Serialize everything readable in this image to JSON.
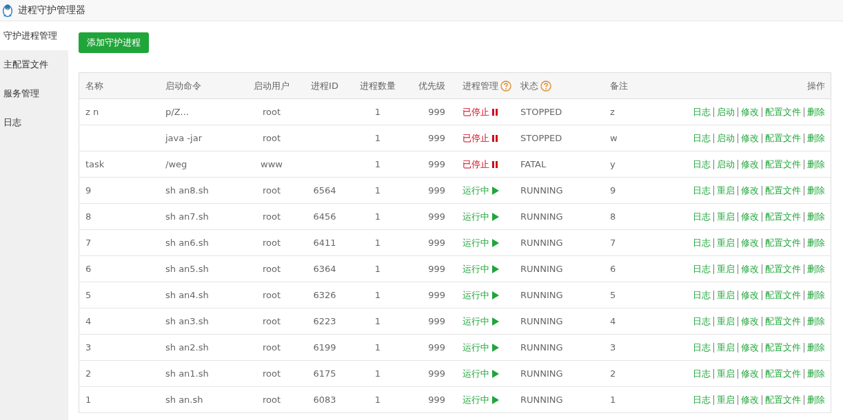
{
  "window": {
    "title": "进程守护管理器"
  },
  "sidebar": {
    "items": [
      {
        "label": "守护进程管理",
        "selected": true
      },
      {
        "label": "主配置文件",
        "selected": false
      },
      {
        "label": "服务管理",
        "selected": false
      },
      {
        "label": "日志",
        "selected": false
      }
    ]
  },
  "add_button": "添加守护进程",
  "table": {
    "columns": [
      {
        "label": "名称",
        "help": false
      },
      {
        "label": "启动命令",
        "help": false
      },
      {
        "label": "启动用户",
        "help": false
      },
      {
        "label": "进程ID",
        "help": false
      },
      {
        "label": "进程数量",
        "help": false
      },
      {
        "label": "优先级",
        "help": false
      },
      {
        "label": "进程管理",
        "help": true
      },
      {
        "label": "状态",
        "help": true
      },
      {
        "label": "备注",
        "help": false
      },
      {
        "label": "操作",
        "help": false
      }
    ],
    "rows": [
      {
        "name": "z n",
        "command": "p/Z...",
        "user": "root",
        "pid": "",
        "count": "1",
        "priority": "999",
        "manage": {
          "kind": "stopped",
          "label": "已停止"
        },
        "status": "STOPPED",
        "remark": "z",
        "actions": [
          "日志",
          "启动",
          "修改",
          "配置文件",
          "删除"
        ]
      },
      {
        "name": "",
        "command": "java -jar",
        "user": "root",
        "pid": "",
        "count": "1",
        "priority": "999",
        "manage": {
          "kind": "stopped",
          "label": "已停止"
        },
        "status": "STOPPED",
        "remark": "w",
        "actions": [
          "日志",
          "启动",
          "修改",
          "配置文件",
          "删除"
        ]
      },
      {
        "name": "task",
        "command": "/weg",
        "user": "www",
        "pid": "",
        "count": "1",
        "priority": "999",
        "manage": {
          "kind": "stopped",
          "label": "已停止"
        },
        "status": "FATAL",
        "remark": "y",
        "actions": [
          "日志",
          "启动",
          "修改",
          "配置文件",
          "删除"
        ]
      },
      {
        "name": "9",
        "command": "sh an8.sh",
        "user": "root",
        "pid": "6564",
        "count": "1",
        "priority": "999",
        "manage": {
          "kind": "running",
          "label": "运行中"
        },
        "status": "RUNNING",
        "remark": "9",
        "actions": [
          "日志",
          "重启",
          "修改",
          "配置文件",
          "删除"
        ]
      },
      {
        "name": "8",
        "command": "sh an7.sh",
        "user": "root",
        "pid": "6456",
        "count": "1",
        "priority": "999",
        "manage": {
          "kind": "running",
          "label": "运行中"
        },
        "status": "RUNNING",
        "remark": "8",
        "actions": [
          "日志",
          "重启",
          "修改",
          "配置文件",
          "删除"
        ]
      },
      {
        "name": "7",
        "command": "sh an6.sh",
        "user": "root",
        "pid": "6411",
        "count": "1",
        "priority": "999",
        "manage": {
          "kind": "running",
          "label": "运行中"
        },
        "status": "RUNNING",
        "remark": "7",
        "actions": [
          "日志",
          "重启",
          "修改",
          "配置文件",
          "删除"
        ]
      },
      {
        "name": "6",
        "command": "sh an5.sh",
        "user": "root",
        "pid": "6364",
        "count": "1",
        "priority": "999",
        "manage": {
          "kind": "running",
          "label": "运行中"
        },
        "status": "RUNNING",
        "remark": "6",
        "actions": [
          "日志",
          "重启",
          "修改",
          "配置文件",
          "删除"
        ]
      },
      {
        "name": "5",
        "command": "sh an4.sh",
        "user": "root",
        "pid": "6326",
        "count": "1",
        "priority": "999",
        "manage": {
          "kind": "running",
          "label": "运行中"
        },
        "status": "RUNNING",
        "remark": "5",
        "actions": [
          "日志",
          "重启",
          "修改",
          "配置文件",
          "删除"
        ]
      },
      {
        "name": "4",
        "command": "sh an3.sh",
        "user": "root",
        "pid": "6223",
        "count": "1",
        "priority": "999",
        "manage": {
          "kind": "running",
          "label": "运行中"
        },
        "status": "RUNNING",
        "remark": "4",
        "actions": [
          "日志",
          "重启",
          "修改",
          "配置文件",
          "删除"
        ]
      },
      {
        "name": "3",
        "command": "sh an2.sh",
        "user": "root",
        "pid": "6199",
        "count": "1",
        "priority": "999",
        "manage": {
          "kind": "running",
          "label": "运行中"
        },
        "status": "RUNNING",
        "remark": "3",
        "actions": [
          "日志",
          "重启",
          "修改",
          "配置文件",
          "删除"
        ]
      },
      {
        "name": "2",
        "command": "sh an1.sh",
        "user": "root",
        "pid": "6175",
        "count": "1",
        "priority": "999",
        "manage": {
          "kind": "running",
          "label": "运行中"
        },
        "status": "RUNNING",
        "remark": "2",
        "actions": [
          "日志",
          "重启",
          "修改",
          "配置文件",
          "删除"
        ]
      },
      {
        "name": "1",
        "command": "sh an.sh",
        "user": "root",
        "pid": "6083",
        "count": "1",
        "priority": "999",
        "manage": {
          "kind": "running",
          "label": "运行中"
        },
        "status": "RUNNING",
        "remark": "1",
        "actions": [
          "日志",
          "重启",
          "修改",
          "配置文件",
          "删除"
        ]
      }
    ]
  }
}
